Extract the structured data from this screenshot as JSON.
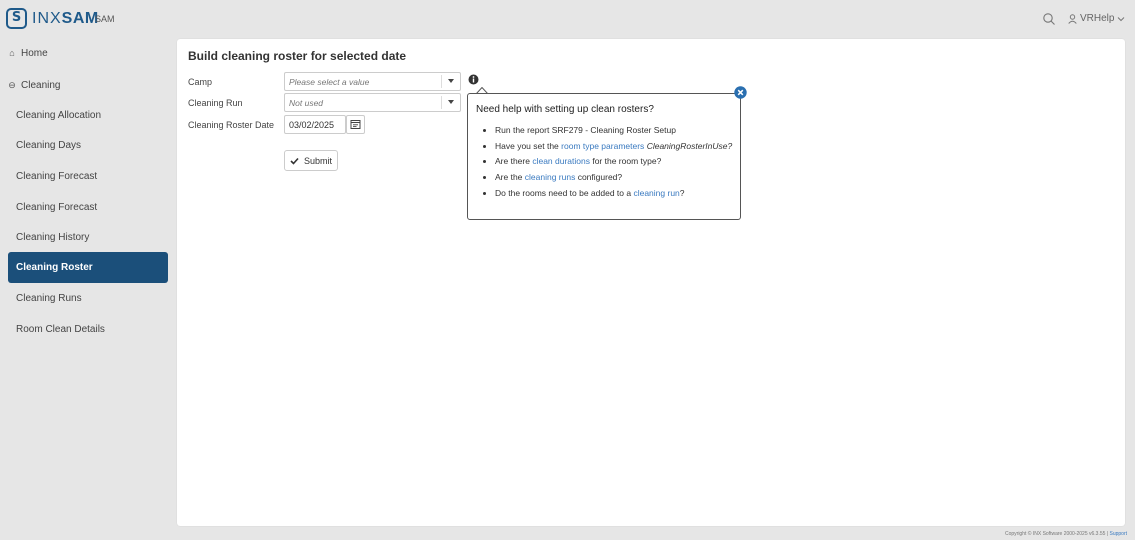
{
  "header": {
    "logo_letter": "S",
    "logo_prefix": "INX",
    "logo_suffix": "SAM",
    "app_name": "SAM",
    "search_icon": "search-icon",
    "user_name": "VRHelp"
  },
  "sidebar": {
    "home_label": "Home",
    "cleaning_label": "Cleaning",
    "items": [
      {
        "label": "Cleaning Allocation",
        "active": false
      },
      {
        "label": "Cleaning Days",
        "active": false
      },
      {
        "label": "Cleaning Forecast",
        "active": false
      },
      {
        "label": "Cleaning Forecast",
        "active": false
      },
      {
        "label": "Cleaning History",
        "active": false
      },
      {
        "label": "Cleaning Roster",
        "active": true
      },
      {
        "label": "Cleaning Runs",
        "active": false
      },
      {
        "label": "Room Clean Details",
        "active": false
      }
    ]
  },
  "main": {
    "title": "Build cleaning roster for selected date",
    "camp_label": "Camp",
    "camp_value": "Please select a value",
    "run_label": "Cleaning Run",
    "run_value": "Not used",
    "date_label": "Cleaning Roster Date",
    "date_value": "03/02/2025",
    "submit_label": "Submit"
  },
  "help_popup": {
    "title": "Need help with setting up clean rosters?",
    "item1": "Run the report SRF279 - Cleaning Roster Setup",
    "item2_pre": "Have you set the ",
    "item2_link": "room type parameters",
    "item2_em": "CleaningRosterInUse?",
    "item3_pre": "Are there ",
    "item3_link": "clean durations",
    "item3_post": " for the room type?",
    "item4_pre": "Are the ",
    "item4_link": "cleaning runs",
    "item4_post": " configured?",
    "item5_pre": "Do the rooms need to be added to a ",
    "item5_link": "cleaning run",
    "item5_post": "?"
  },
  "footer": {
    "copyright": "Copyright © INX Software 2000-2025 v6.3.55 | ",
    "support_link": "Support"
  },
  "colors": {
    "accent": "#1b4f7a",
    "link": "#3a7ac0",
    "background": "#e6e6e6"
  }
}
